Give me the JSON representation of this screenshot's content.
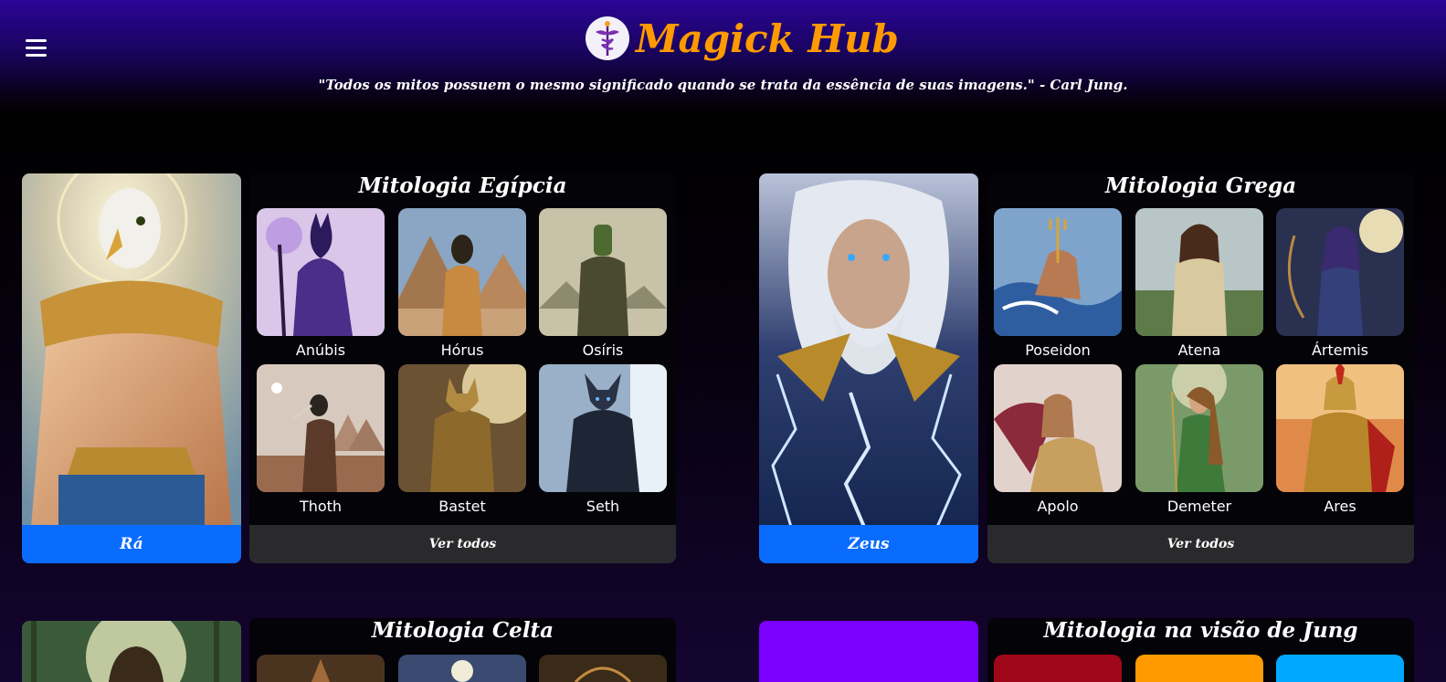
{
  "header": {
    "title": "Magick Hub",
    "quote": "\"Todos os mitos possuem o mesmo significado quando se trata da essência de suas imagens.\" - Carl Jung.",
    "brand_color": "#ff9a00",
    "menu_icon": "hamburger-menu-icon"
  },
  "egipcia": {
    "title": "Mitologia Egípcia",
    "featured": "Rá",
    "items": [
      "Anúbis",
      "Hórus",
      "Osíris",
      "Thoth",
      "Bastet",
      "Seth"
    ],
    "ver_todos": "Ver todos"
  },
  "grega": {
    "title": "Mitologia Grega",
    "featured": "Zeus",
    "items": [
      "Poseidon",
      "Atena",
      "Ártemis",
      "Apolo",
      "Demeter",
      "Ares"
    ],
    "ver_todos": "Ver todos"
  },
  "celta": {
    "title": "Mitologia Celta"
  },
  "jung": {
    "title": "Mitologia na visão de Jung"
  },
  "colors": {
    "accent_blue": "#0a6cff",
    "button_gray": "#2a2a2d",
    "header_purple": "#2a0597",
    "jung_purple": "#7b00ff",
    "jung_red": "#a0071b",
    "jung_orange": "#ff9a00",
    "jung_cyan": "#00a8ff"
  }
}
